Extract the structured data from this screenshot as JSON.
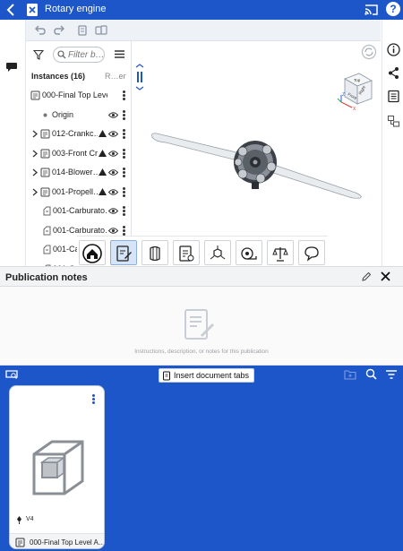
{
  "window": {
    "title": "Rotary engine"
  },
  "icons": {
    "back": "chevron-left-icon",
    "document": "document-icon",
    "cast": "cast-icon",
    "help": "help-icon",
    "comment": "comment-icon",
    "info": "info-icon",
    "share": "share-icon",
    "properties": "properties-icon",
    "configurations": "configurations-icon"
  },
  "toolbar": {
    "undo": "undo-icon",
    "redo": "redo-icon",
    "copy": "copy-icon",
    "paste": "paste-icon"
  },
  "instances": {
    "filter_placeholder": "Filter b…",
    "header": "Instances (16)",
    "header_right": "R…er",
    "rows": [
      {
        "label": "000-Final Top Level As…",
        "type": "assembly"
      },
      {
        "label": "Origin",
        "type": "origin"
      },
      {
        "label": "012-Crankc…",
        "type": "assembly",
        "expandable": true,
        "warning": true
      },
      {
        "label": "003-Front Cra…",
        "type": "assembly",
        "expandable": true,
        "warning": true
      },
      {
        "label": "014-Blower…",
        "type": "assembly",
        "expandable": true,
        "warning": true
      },
      {
        "label": "001-Propell…",
        "type": "assembly",
        "expandable": true,
        "warning": true
      },
      {
        "label": "001-Carburato…",
        "type": "part"
      },
      {
        "label": "001-Carburato…",
        "type": "part"
      },
      {
        "label": "001-Ca…",
        "type": "part"
      },
      {
        "label": "001-Ca…",
        "type": "part"
      }
    ]
  },
  "viewcube": {
    "top": "Top",
    "front": "Front",
    "right": "Right",
    "x": "X",
    "y": "Y",
    "z": "Z"
  },
  "tools": [
    {
      "name": "home-tool",
      "active": false
    },
    {
      "name": "notes-tool",
      "active": true
    },
    {
      "name": "section-view-tool",
      "active": false
    },
    {
      "name": "markup-tool",
      "active": false
    },
    {
      "name": "explode-tool",
      "active": false
    },
    {
      "name": "measure-tool",
      "active": false
    },
    {
      "name": "mass-properties-tool",
      "active": false
    },
    {
      "name": "comment-tool",
      "active": false
    }
  ],
  "publication_notes": {
    "title": "Publication notes",
    "placeholder": "Instructions, description, or notes for this publication"
  },
  "tabs_area": {
    "insert_button": "Insert document tabs",
    "card": {
      "version": "V4",
      "name": "000-Final Top Level A…"
    }
  },
  "colors": {
    "brand_blue": "#1c56c8",
    "active_tool": "#d6e4f8"
  }
}
